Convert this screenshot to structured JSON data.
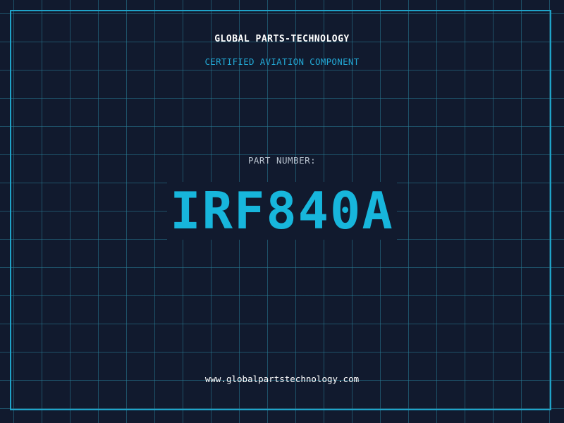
{
  "header": {
    "company": "GLOBAL PARTS-TECHNOLOGY",
    "subtitle": "CERTIFIED AVIATION COMPONENT"
  },
  "part": {
    "label": "PART NUMBER:",
    "number": "IRF840A"
  },
  "footer": {
    "website": "www.globalpartstechnology.com"
  },
  "colors": {
    "background": "#111a2e",
    "grid": "#287d96",
    "frame": "#1fa3c9",
    "accent": "#17b6dc",
    "text": "#ffffff",
    "muted": "#b9c3cf"
  }
}
